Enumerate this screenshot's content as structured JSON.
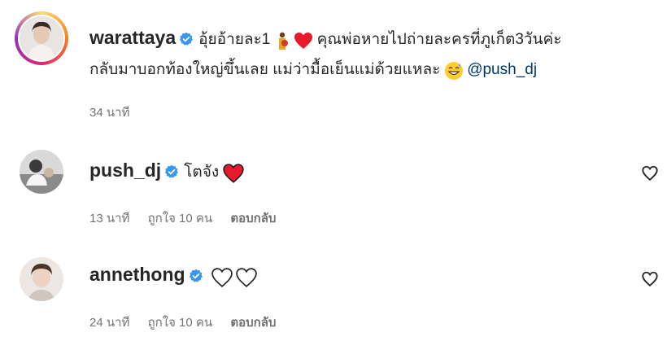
{
  "comments": [
    {
      "username": "warattaya",
      "text_part1": "อุ้ยอ้ายละ1",
      "text_part2": "คุณพ่อหายไปถ่ายละครที่ภูเก็ต3วันค่ะ",
      "text_line2": "กลับมาบอกท้องใหญ่ขึ้นเลย แม่ว่ามื้อเย็นแม่ด้วยแหละ",
      "mention": "@push_dj",
      "time": "34 นาที"
    },
    {
      "username": "push_dj",
      "text": "โตจัง",
      "time": "13 นาที",
      "likes": "ถูกใจ 10 คน",
      "reply_label": "ตอบกลับ"
    },
    {
      "username": "annethong",
      "text": "",
      "time": "24 นาที",
      "likes": "ถูกใจ 10 คน",
      "reply_label": "ตอบกลับ"
    }
  ],
  "colors": {
    "verified": "#3897f0",
    "heart_red": "#ed4956",
    "meta_gray": "#737373",
    "mention": "#00376b"
  },
  "icons": [
    "verified-badge-icon",
    "pregnant-woman-emoji",
    "red-heart-emoji",
    "grinning-sweat-emoji",
    "heart-outline-icon"
  ]
}
